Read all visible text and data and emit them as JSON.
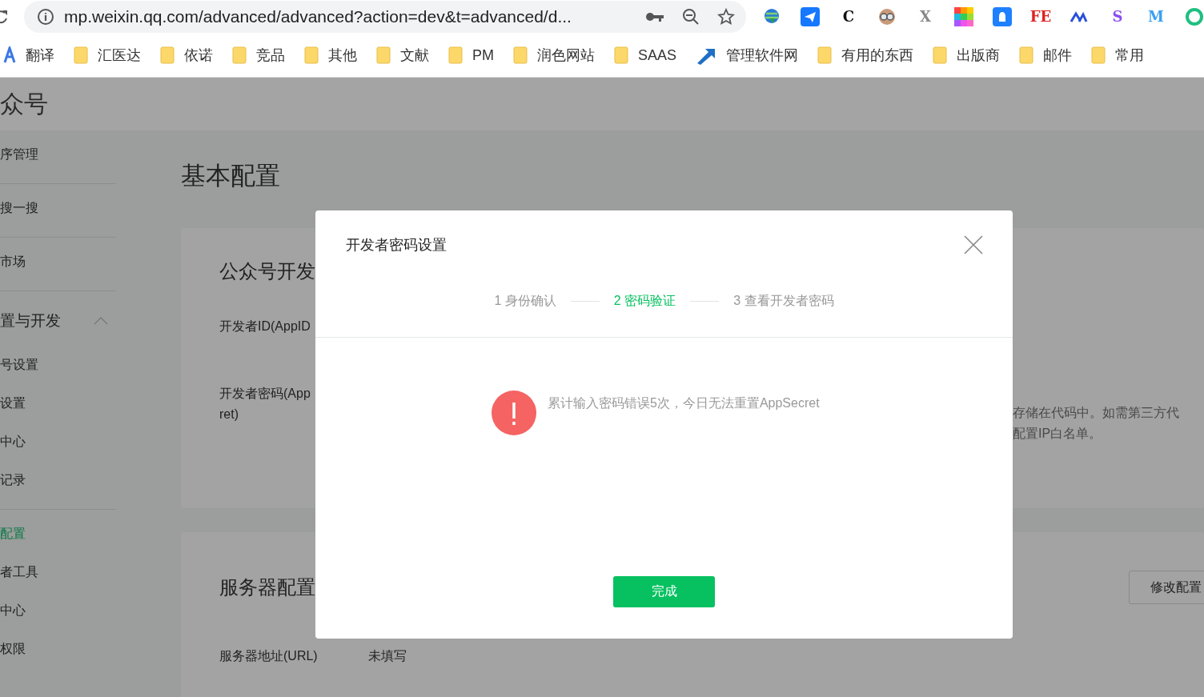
{
  "browser": {
    "url": "mp.weixin.qq.com/advanced/advanced?action=dev&t=advanced/d...",
    "extensions": [
      {
        "kind": "globe"
      },
      {
        "kind": "plane"
      },
      {
        "kind": "letter",
        "glyph": "C",
        "color": "#111111"
      },
      {
        "kind": "goggles"
      },
      {
        "kind": "letter",
        "glyph": "X",
        "color": "#888888"
      },
      {
        "kind": "grid"
      },
      {
        "kind": "bird"
      },
      {
        "kind": "letter",
        "glyph": "FE",
        "color": "#e02020"
      },
      {
        "kind": "peaks"
      },
      {
        "kind": "letter",
        "glyph": "S",
        "color": "#8a4ef0"
      },
      {
        "kind": "letter",
        "glyph": "M",
        "color": "#3aa0f0"
      },
      {
        "kind": "ring"
      }
    ],
    "bookmarks": [
      {
        "kind": "translate",
        "label": "翻译"
      },
      {
        "kind": "folder",
        "label": "汇医达"
      },
      {
        "kind": "folder",
        "label": "依诺"
      },
      {
        "kind": "folder",
        "label": "竞品"
      },
      {
        "kind": "folder",
        "label": "其他"
      },
      {
        "kind": "folder",
        "label": "文献"
      },
      {
        "kind": "folder",
        "label": "PM"
      },
      {
        "kind": "folder",
        "label": "润色网站"
      },
      {
        "kind": "folder",
        "label": "SAAS"
      },
      {
        "kind": "arrow",
        "label": "管理软件网"
      },
      {
        "kind": "folder",
        "label": "有用的东西"
      },
      {
        "kind": "folder",
        "label": "出版商"
      },
      {
        "kind": "folder",
        "label": "邮件"
      },
      {
        "kind": "folder",
        "label": "常用"
      }
    ]
  },
  "header": {
    "title": "众号"
  },
  "sidebar": {
    "groups": [
      {
        "items": [
          {
            "label": "序管理",
            "selected": false
          }
        ]
      },
      {
        "items": [
          {
            "label": "搜一搜",
            "selected": false
          }
        ]
      },
      {
        "items": [
          {
            "label": "市场",
            "selected": false
          }
        ]
      },
      {
        "title": "置与开发",
        "expanded": true,
        "items": [
          {
            "label": "号设置",
            "selected": false
          },
          {
            "label": "设置",
            "selected": false
          },
          {
            "label": "中心",
            "selected": false
          },
          {
            "label": "记录",
            "selected": false
          }
        ]
      },
      {
        "items": [
          {
            "label": "配置",
            "selected": true
          },
          {
            "label": "者工具",
            "selected": false
          },
          {
            "label": "中心",
            "selected": false
          },
          {
            "label": "权限",
            "selected": false
          }
        ]
      }
    ]
  },
  "main": {
    "title": "基本配置",
    "cards": [
      {
        "title": "公众号开发",
        "rows": [
          {
            "label": [
              "开发者ID(AppID"
            ]
          },
          {
            "label": [
              "开发者密码(App",
              "ret)"
            ],
            "note": [
              "存储在代码中。如需第三方代",
              "配置IP白名单。"
            ]
          }
        ]
      },
      {
        "title": "服务器配置",
        "button": "修改配置",
        "rows": [
          {
            "label": [
              "服务器地址(URL)"
            ],
            "value": "未填写"
          }
        ]
      }
    ]
  },
  "dialog": {
    "title": "开发者密码设置",
    "steps": [
      {
        "label": "1 身份确认",
        "selected": false
      },
      {
        "label": "2 密码验证",
        "selected": true
      },
      {
        "label": "3 查看开发者密码",
        "selected": false
      }
    ],
    "message": {
      "kind": "error",
      "text": "累计输入密码错误5次，今日无法重置AppSecret"
    },
    "button": "完成"
  }
}
